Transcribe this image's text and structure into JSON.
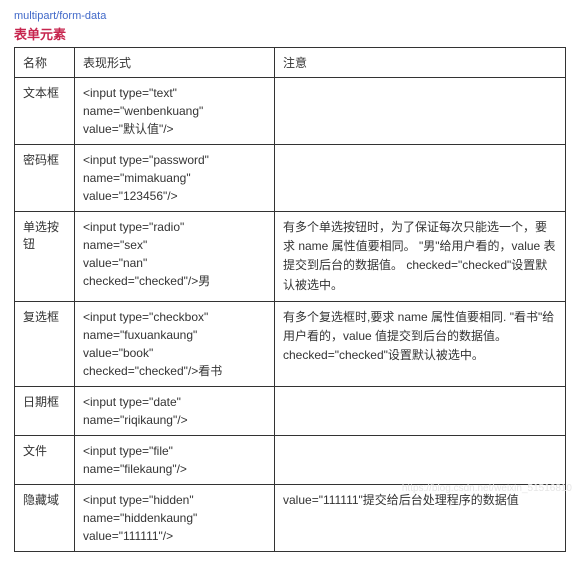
{
  "header": {
    "top_link_fragment": "multipart/form-data",
    "title": "表单元素"
  },
  "columns": {
    "name": "名称",
    "form": "表现形式",
    "note": "注意"
  },
  "rows": [
    {
      "name": "文本框",
      "form": "<input type=\"text\"\nname=\"wenbenkuang\"\nvalue=\"默认值\"/>",
      "note": ""
    },
    {
      "name": "密码框",
      "form": "<input type=\"password\"\nname=\"mimakuang\"\nvalue=\"123456\"/>",
      "note": ""
    },
    {
      "name": "单选按钮",
      "form": "<input type=\"radio\"\nname=\"sex\"\nvalue=\"nan\"\nchecked=\"checked\"/>男",
      "note": "有多个单选按钮时，为了保证每次只能选一个，要求 name 属性值要相同。\n\"男\"给用户看的，value 表提交到后台的数据值。\nchecked=\"checked\"设置默认被选中。"
    },
    {
      "name": "复选框",
      "form": "<input type=\"checkbox\"\nname=\"fuxuankaung\"\nvalue=\"book\"\nchecked=\"checked\"/>看书",
      "note": "有多个复选框时,要求 name 属性值要相同.\n\"看书\"给用户看的，value 值提交到后台的数据值。\nchecked=\"checked\"设置默认被选中。"
    },
    {
      "name": "日期框",
      "form": "<input type=\"date\"\nname=\"riqikaung\"/>",
      "note": ""
    },
    {
      "name": "文件",
      "form": "<input type=\"file\"\n name=\"filekaung\"/>",
      "note": ""
    },
    {
      "name": "隐藏域",
      "form": "<input type=\"hidden\"\n name=\"hiddenkaung\"\nvalue=\"111111\"/>",
      "note": "value=\"111111\"提交给后台处理程序的数据值"
    }
  ],
  "watermark": "https://blog.csdn.net/weixin_51516810"
}
